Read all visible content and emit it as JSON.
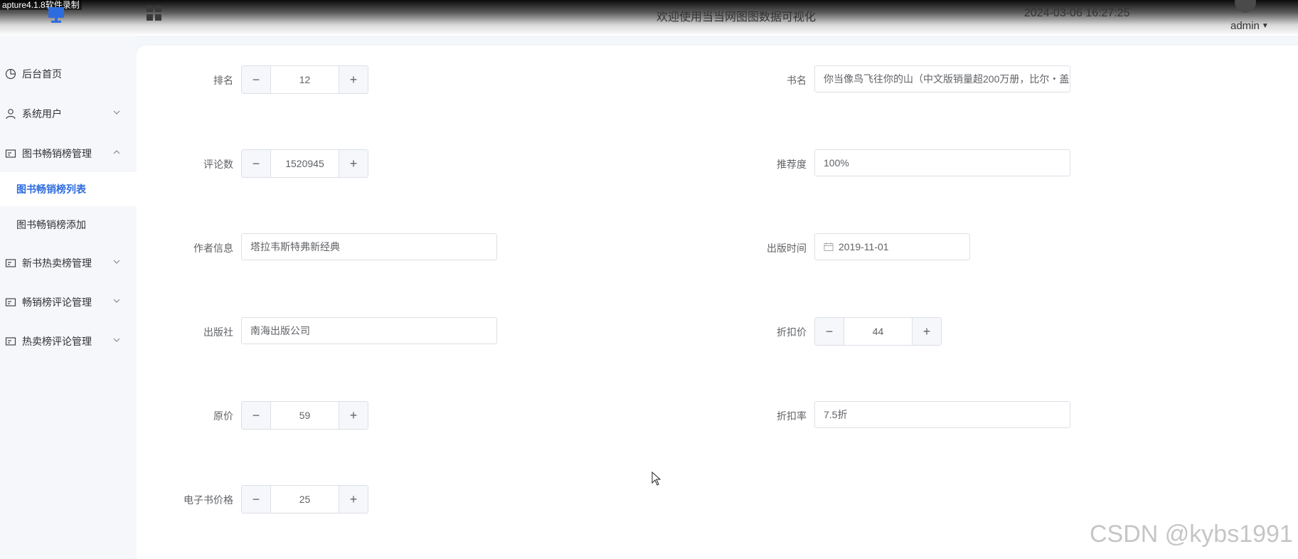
{
  "recorder_label": "apture4.1.8软件录制",
  "header": {
    "welcome": "欢迎使用当当网图图数据可视化",
    "datetime": "2024-03-06 16:27:25",
    "user": "admin"
  },
  "sidebar": {
    "items": [
      {
        "label": "后台首页",
        "icon": "pie-chart-icon"
      },
      {
        "label": "系统用户",
        "icon": "user-icon"
      },
      {
        "label": "图书畅销榜管理",
        "icon": "card-icon"
      },
      {
        "label": "新书热卖榜管理",
        "icon": "card-icon"
      },
      {
        "label": "畅销榜评论管理",
        "icon": "card-icon"
      },
      {
        "label": "热卖榜评论管理",
        "icon": "card-icon"
      }
    ],
    "sub_items": [
      {
        "label": "图书畅销榜列表",
        "active": true
      },
      {
        "label": "图书畅销榜添加",
        "active": false
      }
    ]
  },
  "form": {
    "rank": {
      "label": "排名",
      "value": "12"
    },
    "title": {
      "label": "书名",
      "value": "你当像鸟飞往你的山（中文版销量超200万册，比尔・盖"
    },
    "comments": {
      "label": "评论数",
      "value": "1520945"
    },
    "recommend": {
      "label": "推荐度",
      "value": "100%"
    },
    "author": {
      "label": "作者信息",
      "value": "塔拉韦斯特弗新经典"
    },
    "pub_date": {
      "label": "出版时间",
      "value": "2019-11-01"
    },
    "publisher": {
      "label": "出版社",
      "value": "南海出版公司"
    },
    "discount_price": {
      "label": "折扣价",
      "value": "44"
    },
    "original_price": {
      "label": "原价",
      "value": "59"
    },
    "discount_rate": {
      "label": "折扣率",
      "value": "7.5折"
    },
    "ebook_price": {
      "label": "电子书价格",
      "value": "25"
    }
  },
  "stepper": {
    "minus": "−",
    "plus": "+"
  },
  "watermark": "CSDN @kybs1991",
  "colors": {
    "accent": "#2d6cdf",
    "sidebar_bg": "#f5f7fa"
  }
}
